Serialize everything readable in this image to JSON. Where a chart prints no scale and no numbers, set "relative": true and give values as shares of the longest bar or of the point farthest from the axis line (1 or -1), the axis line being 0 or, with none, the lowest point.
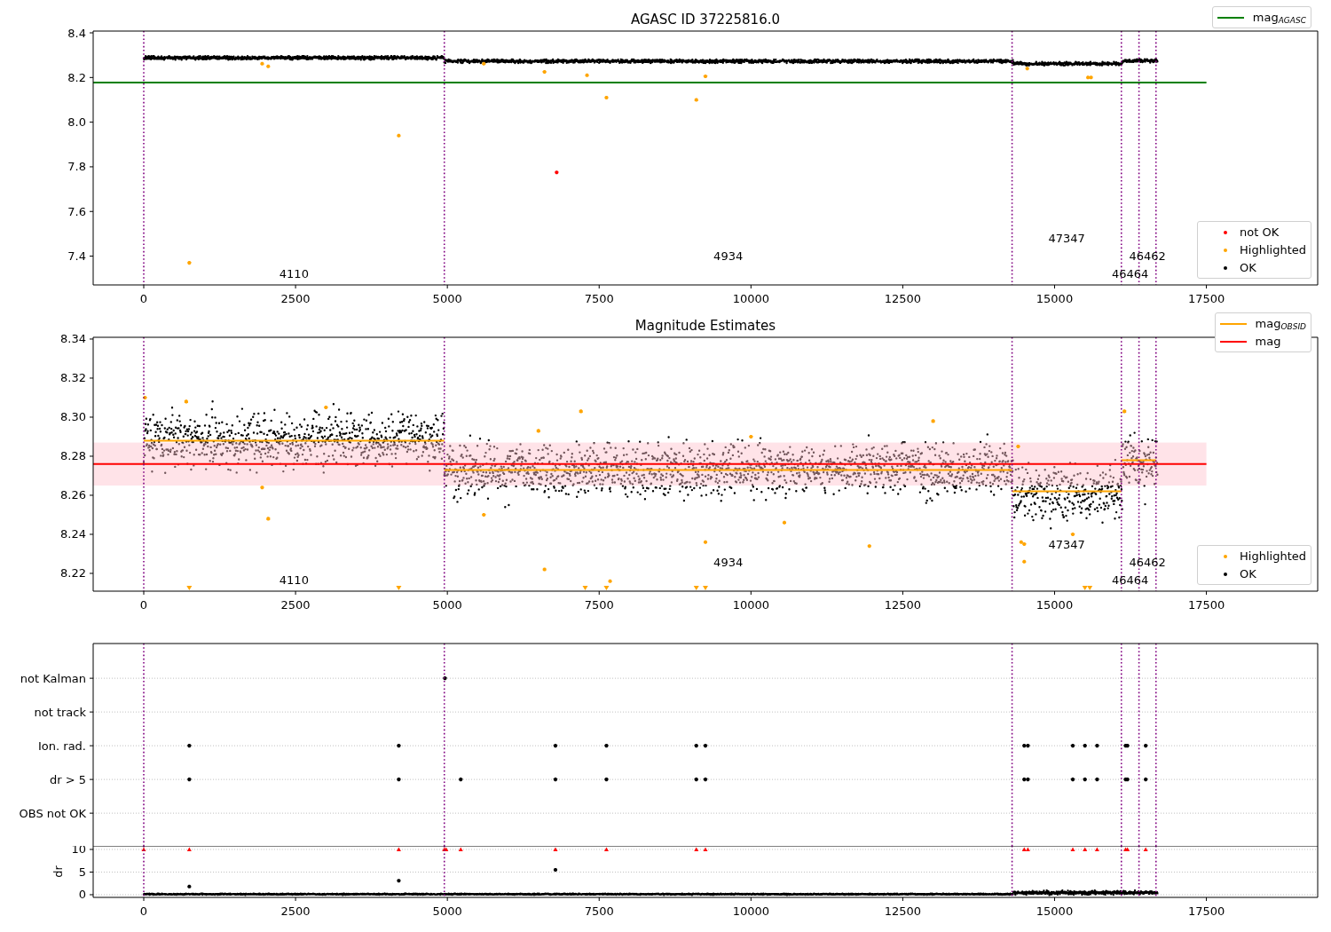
{
  "panels": [
    {
      "chart_data": {
        "type": "scatter",
        "title": "AGASC ID 37225816.0",
        "xlim": [
          -833,
          19333
        ],
        "ylim": [
          7.271,
          8.408
        ],
        "xticks": [
          0,
          2500,
          5000,
          7500,
          10000,
          12500,
          15000,
          17500
        ],
        "yticks": [
          {
            "value": 7.4,
            "label": "7.4"
          },
          {
            "value": 7.6,
            "label": "7.6"
          },
          {
            "value": 7.8,
            "label": "7.8"
          },
          {
            "value": 8.0,
            "label": "8.0"
          },
          {
            "value": 8.2,
            "label": "8.2"
          },
          {
            "value": 8.4,
            "label": "8.4"
          }
        ],
        "series": [
          {
            "type": "line",
            "color": "#008000",
            "x": [
              -833,
              17500
            ],
            "values": [
              8.177,
              8.177
            ]
          },
          {
            "type": "scatter",
            "color": "#ff0000",
            "x": [
              6800
            ],
            "values": [
              7.775
            ]
          },
          {
            "type": "scatter",
            "color": "#ffa500",
            "x": [
              750,
              4200,
              7620,
              9100,
              7300,
              6600,
              9250,
              2050,
              15550,
              15600,
              14550,
              1950,
              5600
            ],
            "values": [
              7.37,
              7.94,
              8.11,
              8.1,
              8.21,
              8.225,
              8.205,
              8.25,
              8.2,
              8.2,
              8.24,
              8.262,
              8.262
            ]
          }
        ],
        "ref_lines": [
          {
            "axis": "x",
            "value": 0,
            "color": "#800080"
          },
          {
            "axis": "x",
            "value": 4950,
            "color": "#800080"
          },
          {
            "axis": "x",
            "value": 14300,
            "color": "#800080"
          },
          {
            "axis": "x",
            "value": 16100,
            "color": "#800080"
          },
          {
            "axis": "x",
            "value": 16390,
            "color": "#800080"
          },
          {
            "axis": "x",
            "value": 16670,
            "color": "#800080"
          }
        ],
        "annotations": [
          "4110",
          "4934",
          "47347",
          "46464",
          "46462"
        ]
      },
      "legends": [
        [
          {
            "kind": "line",
            "label": "mag$_{AGASC}$",
            "color": "#008000"
          }
        ],
        [
          {
            "kind": "marker",
            "label": "not OK",
            "color": "#ff0000"
          },
          {
            "kind": "marker",
            "label": "Highlighted",
            "color": "#ffa500"
          },
          {
            "kind": "marker",
            "label": "OK",
            "color": "#000000"
          }
        ]
      ]
    },
    {
      "chart_data": {
        "type": "scatter",
        "title": "Magnitude Estimates",
        "xlim": [
          -833,
          19333
        ],
        "ylim": [
          8.2109,
          8.3409
        ],
        "xticks": [
          0,
          2500,
          5000,
          7500,
          10000,
          12500,
          15000,
          17500
        ],
        "yticks": [
          {
            "value": 8.22,
            "label": "8.22"
          },
          {
            "value": 8.24,
            "label": "8.24"
          },
          {
            "value": 8.26,
            "label": "8.26"
          },
          {
            "value": 8.28,
            "label": "8.28"
          },
          {
            "value": 8.3,
            "label": "8.30"
          },
          {
            "value": 8.32,
            "label": "8.32"
          },
          {
            "value": 8.34,
            "label": "8.34"
          }
        ],
        "bands": [
          {
            "axis": "y",
            "from": 8.265,
            "to": 8.287,
            "color": "#ffc0cb"
          }
        ],
        "series": [
          {
            "type": "line",
            "color": "#ff0000",
            "x": [
              -833,
              17500
            ],
            "values": [
              8.276,
              8.276
            ]
          },
          {
            "type": "line",
            "color": "#ffa500",
            "x": [
              0,
              4950
            ],
            "values": [
              8.288,
              8.288
            ]
          },
          {
            "type": "line",
            "color": "#ffa500",
            "x": [
              4950,
              14300
            ],
            "values": [
              8.273,
              8.273
            ]
          },
          {
            "type": "line",
            "color": "#ffa500",
            "x": [
              14300,
              16100
            ],
            "values": [
              8.262,
              8.262
            ]
          },
          {
            "type": "line",
            "color": "#ffa500",
            "x": [
              16100,
              16670
            ],
            "values": [
              8.278,
              8.278
            ]
          },
          {
            "type": "scatter",
            "color": "#ffa500",
            "x": [
              6600,
              7680,
              9250,
              11950,
              2050,
              1950,
              7200,
              16150,
              10550,
              10000,
              3000,
              14400,
              14500,
              14500,
              14450,
              15300,
              5600,
              6500,
              13000,
              700,
              20
            ],
            "values": [
              8.222,
              8.216,
              8.236,
              8.234,
              8.248,
              8.264,
              8.303,
              8.303,
              8.246,
              8.29,
              8.305,
              8.285,
              8.226,
              8.235,
              8.236,
              8.24,
              8.25,
              8.293,
              8.298,
              8.308,
              8.31
            ]
          },
          {
            "type": "scatter",
            "marker": "v",
            "color": "#ffa500",
            "x": [
              750,
              4200,
              7270,
              7620,
              9100,
              9250,
              15500,
              15580
            ],
            "values": [
              8.2125,
              8.2125,
              8.2125,
              8.2125,
              8.2125,
              8.2125,
              8.2125,
              8.2125
            ]
          }
        ],
        "ref_lines": [
          {
            "axis": "x",
            "value": 0,
            "color": "#800080"
          },
          {
            "axis": "x",
            "value": 4950,
            "color": "#800080"
          },
          {
            "axis": "x",
            "value": 14300,
            "color": "#800080"
          },
          {
            "axis": "x",
            "value": 16100,
            "color": "#800080"
          },
          {
            "axis": "x",
            "value": 16390,
            "color": "#800080"
          },
          {
            "axis": "x",
            "value": 16670,
            "color": "#800080"
          }
        ],
        "annotations": [
          "4110",
          "4934",
          "47347",
          "46464",
          "46462"
        ]
      },
      "legends": [
        [
          {
            "kind": "line",
            "label": "mag$_{OBSID}$",
            "color": "#ffa500"
          },
          {
            "kind": "line",
            "label": "mag",
            "color": "#ff0000"
          }
        ],
        [
          {
            "kind": "marker",
            "label": "Highlighted",
            "color": "#ffa500"
          },
          {
            "kind": "marker",
            "label": "OK",
            "color": "#000000"
          }
        ]
      ]
    },
    {
      "chart_data": {
        "type": "scatter",
        "orientation": "horizontal",
        "grid": true,
        "relative": true,
        "xlim": [
          -833,
          19333
        ],
        "categories": [
          "not Kalman",
          "not track",
          "Ion. rad.",
          "dr > 5",
          "OBS not OK"
        ],
        "series": [
          {
            "type": "scatter",
            "color": "#000000",
            "values": [
              4960,
              null,
              null,
              null,
              null
            ]
          },
          {
            "type": "scatter",
            "color": "#000000",
            "values": [
              null,
              null,
              750,
              750,
              null
            ]
          },
          {
            "type": "scatter",
            "color": "#000000",
            "values": [
              null,
              null,
              4200,
              4200,
              null
            ]
          },
          {
            "type": "scatter",
            "color": "#000000",
            "values": [
              null,
              null,
              null,
              5220,
              null
            ]
          },
          {
            "type": "scatter",
            "color": "#000000",
            "values": [
              null,
              null,
              6780,
              6780,
              null
            ]
          },
          {
            "type": "scatter",
            "color": "#000000",
            "values": [
              null,
              null,
              7620,
              7620,
              null
            ]
          },
          {
            "type": "scatter",
            "color": "#000000",
            "values": [
              null,
              null,
              9100,
              9100,
              null
            ]
          },
          {
            "type": "scatter",
            "color": "#000000",
            "values": [
              null,
              null,
              9250,
              9250,
              null
            ]
          },
          {
            "type": "scatter",
            "color": "#000000",
            "values": [
              null,
              null,
              14500,
              14500,
              null
            ]
          },
          {
            "type": "scatter",
            "color": "#000000",
            "values": [
              null,
              null,
              14560,
              14560,
              null
            ]
          },
          {
            "type": "scatter",
            "color": "#000000",
            "values": [
              null,
              null,
              15300,
              15300,
              null
            ]
          },
          {
            "type": "scatter",
            "color": "#000000",
            "values": [
              null,
              null,
              15500,
              15500,
              null
            ]
          },
          {
            "type": "scatter",
            "color": "#000000",
            "values": [
              null,
              null,
              15700,
              15700,
              null
            ]
          },
          {
            "type": "scatter",
            "color": "#000000",
            "values": [
              null,
              null,
              16170,
              16170,
              null
            ]
          },
          {
            "type": "scatter",
            "color": "#000000",
            "values": [
              null,
              null,
              16200,
              16200,
              null
            ]
          },
          {
            "type": "scatter",
            "color": "#000000",
            "values": [
              null,
              null,
              16500,
              16500,
              null
            ]
          }
        ],
        "ref_lines": [
          {
            "axis": "x",
            "value": 0,
            "color": "#800080"
          },
          {
            "axis": "x",
            "value": 4950,
            "color": "#800080"
          },
          {
            "axis": "x",
            "value": 14300,
            "color": "#800080"
          },
          {
            "axis": "x",
            "value": 16100,
            "color": "#800080"
          },
          {
            "axis": "x",
            "value": 16390,
            "color": "#800080"
          },
          {
            "axis": "x",
            "value": 16670,
            "color": "#800080"
          }
        ]
      }
    },
    {
      "chart_data": {
        "type": "scatter",
        "ylabel": "dr",
        "grid": true,
        "xlim": [
          -833,
          19333
        ],
        "ylim": [
          -0.59,
          10.78
        ],
        "xticks": [
          0,
          2500,
          5000,
          7500,
          10000,
          12500,
          15000,
          17500
        ],
        "yticks": [
          {
            "value": 0,
            "label": "0"
          },
          {
            "value": 5,
            "label": "5"
          },
          {
            "value": 10,
            "label": "10"
          }
        ],
        "series": [
          {
            "type": "scatter",
            "marker": "^",
            "color": "#ff0000",
            "x": [
              0,
              750,
              4200,
              4950,
              4980,
              5220,
              6780,
              7620,
              9100,
              9250,
              14500,
              14560,
              15300,
              15500,
              15700,
              16170,
              16200,
              16500
            ],
            "values": [
              10,
              10,
              10,
              10,
              10,
              10,
              10,
              10,
              10,
              10,
              10,
              10,
              10,
              10,
              10,
              10,
              10,
              10
            ]
          },
          {
            "type": "scatter",
            "color": "#000000",
            "x": [
              750,
              4200,
              6780
            ],
            "values": [
              1.8,
              3.1,
              5.5
            ]
          }
        ],
        "ref_lines": [
          {
            "axis": "x",
            "value": 0,
            "color": "#800080"
          },
          {
            "axis": "x",
            "value": 4950,
            "color": "#800080"
          },
          {
            "axis": "x",
            "value": 14300,
            "color": "#800080"
          },
          {
            "axis": "x",
            "value": 16100,
            "color": "#800080"
          },
          {
            "axis": "x",
            "value": 16390,
            "color": "#800080"
          },
          {
            "axis": "x",
            "value": 16670,
            "color": "#800080"
          }
        ]
      }
    }
  ]
}
